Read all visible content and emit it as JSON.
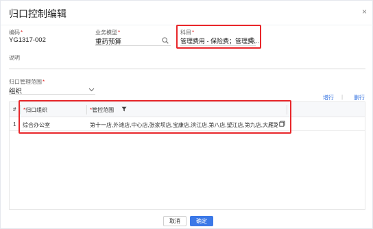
{
  "dialog": {
    "title": "归口控制编辑",
    "close_icon": "×"
  },
  "form": {
    "code": {
      "label": "编码",
      "value": "YG1317-002"
    },
    "business_model": {
      "label": "业务模型",
      "value": "重药预算"
    },
    "subject": {
      "label": "科目",
      "value": "管理费用 - 保险费；管理费…"
    },
    "description": {
      "label": "说明",
      "value": ""
    },
    "scope_type": {
      "label": "归口管理范围",
      "value": "组织"
    }
  },
  "table_actions": {
    "add_row": "增行",
    "separator": "|",
    "delete_row": "删行"
  },
  "table": {
    "columns": [
      "#",
      "归口组织",
      "管控范围"
    ],
    "rows": [
      {
        "index": "1",
        "org": "综合办公室",
        "scope": "第十一店,外滩店,中心店,张家坝店,宝康店,滨江店,第八店,望江店,第九店,大雁路,第十二店,民流店…"
      }
    ]
  },
  "footer": {
    "cancel": "取消",
    "confirm": "确定"
  },
  "colors": {
    "accent": "#3b78e7",
    "highlight": "#e8262a",
    "required": "#e02020"
  }
}
